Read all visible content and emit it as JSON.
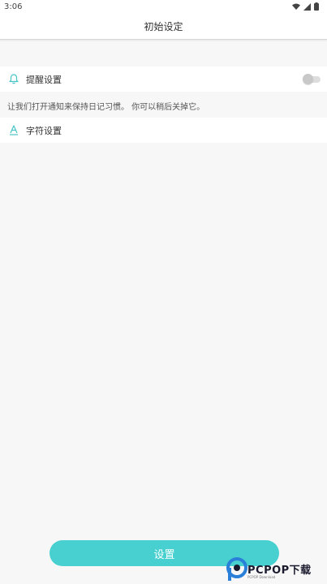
{
  "status": {
    "time": "3:06",
    "icons": [
      "wifi-icon",
      "signal-icon",
      "battery-icon"
    ]
  },
  "appbar": {
    "title": "初始设定"
  },
  "settings": [
    {
      "icon": "bell-icon",
      "label": "提醒设置",
      "toggle": false
    },
    {
      "icon": "font-a-icon",
      "label": "字符设置"
    }
  ],
  "hint": "让我们打开通知来保持日记习惯。 你可以稍后关掉它。",
  "button": {
    "label": "设置"
  },
  "watermark": {
    "brand": "PCPOP下载",
    "sub": "PCPOP Download"
  },
  "colors": {
    "accent": "#48d0d0",
    "background": "#f7f7f7"
  }
}
